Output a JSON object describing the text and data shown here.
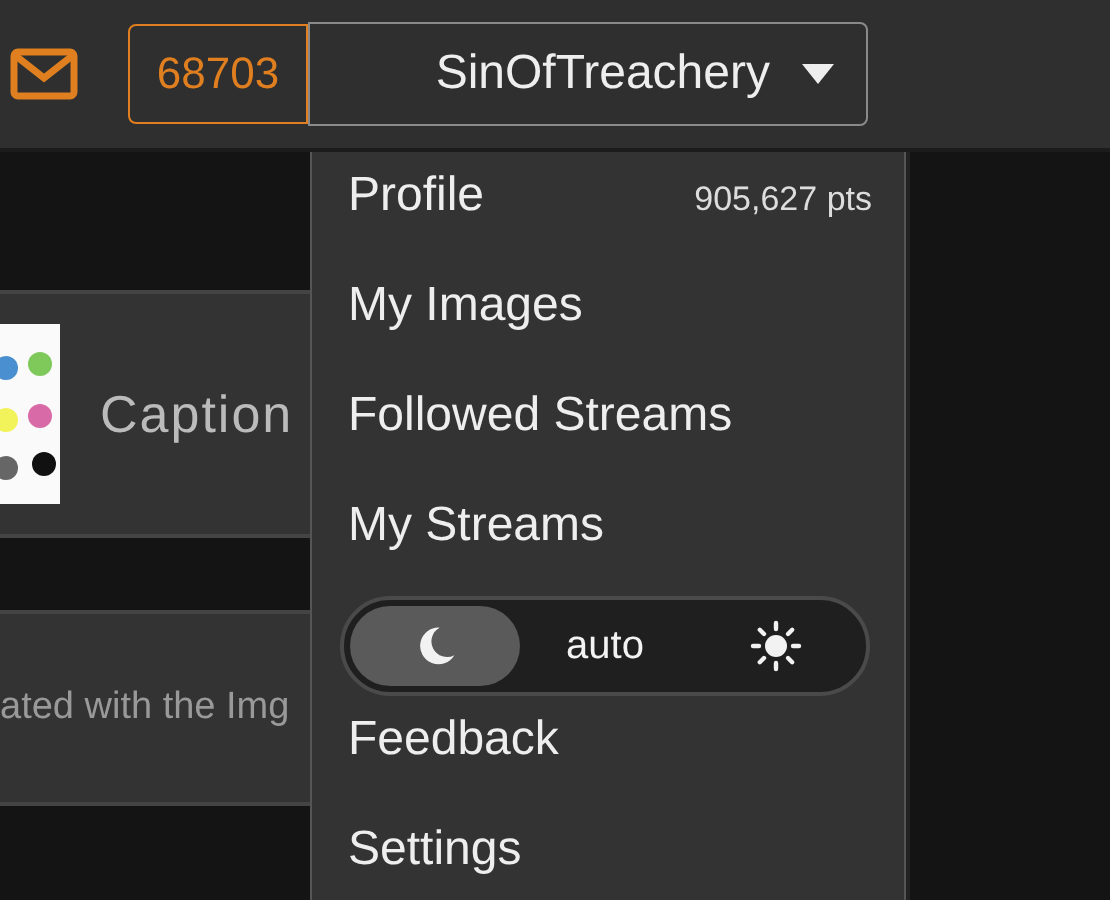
{
  "header": {
    "points": "68703",
    "username": "SinOfTreachery"
  },
  "feed": {
    "caption": "Caption",
    "description": "ated with the Img"
  },
  "user_menu": {
    "profile": {
      "label": "Profile",
      "points": "905,627 pts"
    },
    "items": [
      "My Images",
      "Followed Streams",
      "My Streams"
    ],
    "theme_toggle": [
      {
        "kind": "moon",
        "selected": true
      },
      {
        "kind": "text",
        "label": "auto",
        "selected": false
      },
      {
        "kind": "sun",
        "selected": false
      }
    ],
    "bottom_items": [
      "Feedback",
      "Settings"
    ]
  }
}
